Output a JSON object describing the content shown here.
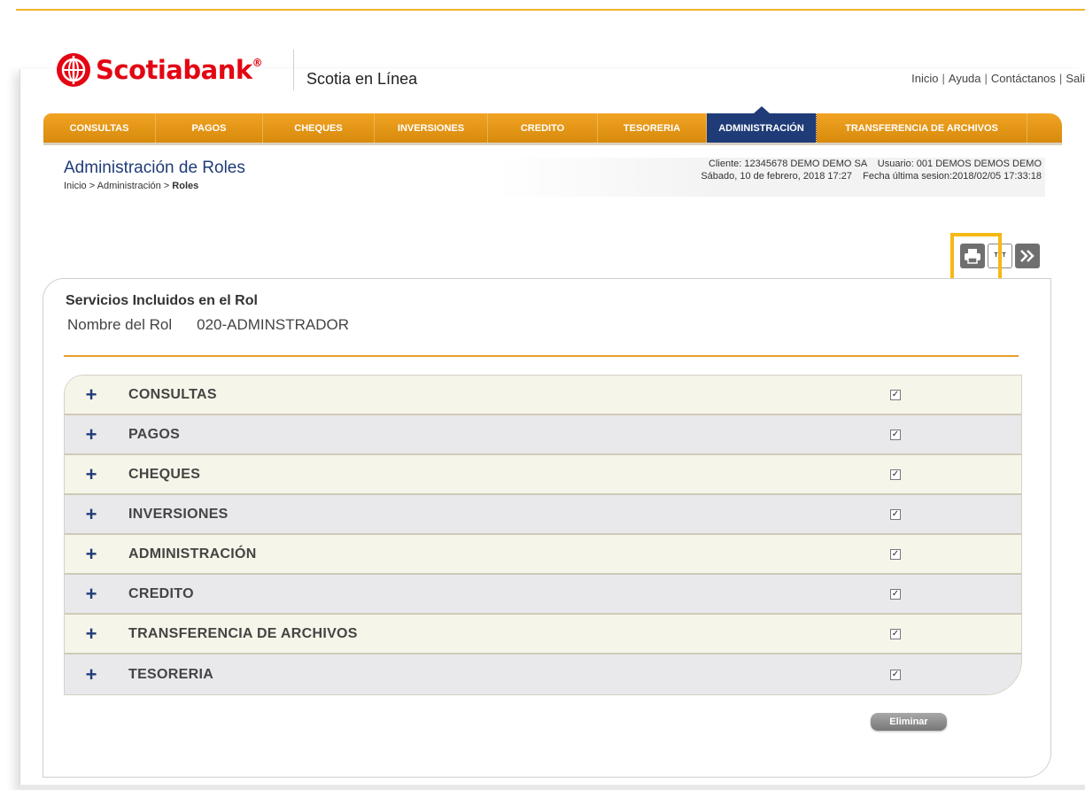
{
  "brand": {
    "name": "Scotiabank",
    "registered": "®",
    "app_title": "Scotia en Línea",
    "accent": "#e30613"
  },
  "top_links": [
    "Inicio",
    "Ayuda",
    "Contáctanos",
    "Sali"
  ],
  "top_links_sep": "|",
  "nav": {
    "items": [
      "CONSULTAS",
      "PAGOS",
      "CHEQUES",
      "INVERSIONES",
      "CREDITO",
      "TESORERIA",
      "ADMINISTRACIÓN",
      "TRANSFERENCIA DE ARCHIVOS"
    ],
    "active": "ADMINISTRACIÓN"
  },
  "page": {
    "heading": "Administración de Roles",
    "breadcrumb_prefix": "Inicio > Administración > ",
    "breadcrumb_current": "Roles"
  },
  "session": {
    "line1": "Cliente: 12345678 DEMO DEMO SA    Usuario: 001 DEMOS DEMOS DEMO",
    "line2": "Sábado, 10 de febrero, 2018 17:27    Fecha última sesion:2018/02/05 17:33:18"
  },
  "tools": {
    "print_icon": "printer-icon",
    "txt_label": "TXT",
    "next_icon": "double-chevron-right-icon"
  },
  "panel": {
    "title": "Servicios Incluidos en el Rol",
    "role_label": "Nombre del Rol",
    "role_value": "020-ADMINSTRADOR"
  },
  "services": [
    {
      "label": "CONSULTAS",
      "checked": true
    },
    {
      "label": "PAGOS",
      "checked": true
    },
    {
      "label": "CHEQUES",
      "checked": true
    },
    {
      "label": "INVERSIONES",
      "checked": true
    },
    {
      "label": "ADMINISTRACIÓN",
      "checked": true
    },
    {
      "label": "CREDITO",
      "checked": true
    },
    {
      "label": "TRANSFERENCIA DE ARCHIVOS",
      "checked": true
    },
    {
      "label": "TESORERIA",
      "checked": true
    }
  ],
  "services_expand_symbol": "+",
  "actions": {
    "delete_label": "Eliminar"
  },
  "colors": {
    "nav_orange": "#e8961a",
    "nav_active": "#1f3c78",
    "highlight": "#f5b915"
  }
}
